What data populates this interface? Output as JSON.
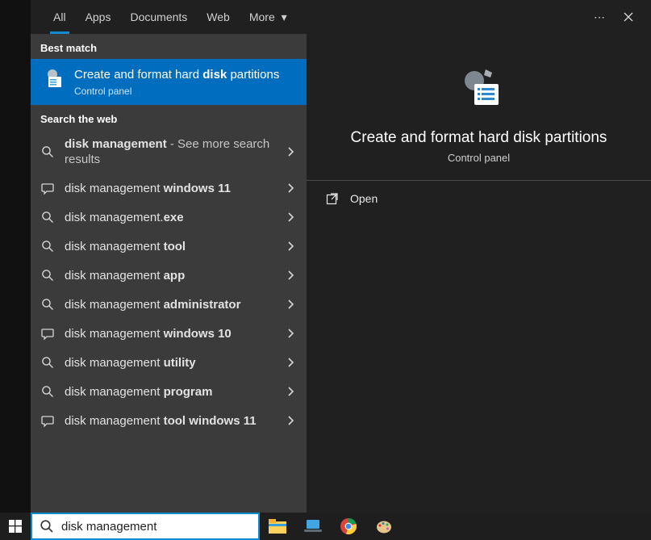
{
  "tabs": {
    "all": "All",
    "apps": "Apps",
    "documents": "Documents",
    "web": "Web",
    "more": "More"
  },
  "sections": {
    "best_match": "Best match",
    "search_web": "Search the web"
  },
  "best_match": {
    "title_pre": "Create and format hard ",
    "title_bold": "disk",
    "title_post": " partitions",
    "subtitle": "Control panel"
  },
  "web_results": [
    {
      "icon": "search",
      "pre": "",
      "mid": "disk management",
      "post": "",
      "tail": " - See more search results"
    },
    {
      "icon": "chat",
      "pre": "disk management ",
      "mid": "windows 11",
      "post": "",
      "tail": ""
    },
    {
      "icon": "search",
      "pre": "disk management.",
      "mid": "exe",
      "post": "",
      "tail": ""
    },
    {
      "icon": "search",
      "pre": "disk management ",
      "mid": "tool",
      "post": "",
      "tail": ""
    },
    {
      "icon": "search",
      "pre": "disk management ",
      "mid": "app",
      "post": "",
      "tail": ""
    },
    {
      "icon": "search",
      "pre": "disk management ",
      "mid": "administrator",
      "post": "",
      "tail": ""
    },
    {
      "icon": "chat",
      "pre": "disk management ",
      "mid": "windows 10",
      "post": "",
      "tail": ""
    },
    {
      "icon": "search",
      "pre": "disk management ",
      "mid": "utility",
      "post": "",
      "tail": ""
    },
    {
      "icon": "search",
      "pre": "disk management ",
      "mid": "program",
      "post": "",
      "tail": ""
    },
    {
      "icon": "chat",
      "pre": "disk management ",
      "mid": "tool windows 11",
      "post": "",
      "tail": ""
    }
  ],
  "detail": {
    "title": "Create and format hard disk partitions",
    "subtitle": "Control panel",
    "open": "Open"
  },
  "search": {
    "value": "disk management"
  }
}
